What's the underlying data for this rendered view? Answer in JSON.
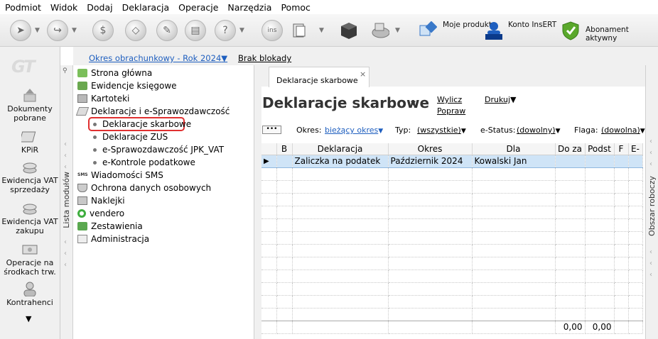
{
  "menu": [
    "Podmiot",
    "Widok",
    "Dodaj",
    "Deklaracja",
    "Operacje",
    "Narzędzia",
    "Pomoc"
  ],
  "toolbar": {
    "moje_produkty": "Moje produkty",
    "konto_insert": "Konto InsERT",
    "abonament": "Abonament aktywny",
    "insert_badge": "InsERT",
    "ins_badge": "ins"
  },
  "logo": "GT",
  "left_strip": [
    {
      "label": "Dokumenty pobrane"
    },
    {
      "label": "KPiR"
    },
    {
      "label": "Ewidencja VAT sprzedaży"
    },
    {
      "label": "Ewidencja VAT zakupu"
    },
    {
      "label": "Operacje na środkach trw."
    },
    {
      "label": "Kontrahenci"
    }
  ],
  "module_strip_label": "Lista modułów",
  "topbar": {
    "okres": "Okres obrachunkowy - Rok 2024",
    "brak_blokady": "Brak blokady"
  },
  "tree": {
    "items": [
      "Strona główna",
      "Ewidencje księgowe",
      "Kartoteki",
      "Deklaracje i e-Sprawozdawczość",
      "Deklaracje skarbowe",
      "Deklaracje ZUS",
      "e-Sprawozdawczość JPK_VAT",
      "e-Kontrole podatkowe",
      "Wiadomości SMS",
      "Ochrona danych osobowych",
      "Naklejki",
      "vendero",
      "Zestawienia",
      "Administracja"
    ],
    "sms_badge": "SMS"
  },
  "tab": {
    "label": "Deklaracje skarbowe",
    "close": "×"
  },
  "main": {
    "title": "Deklaracje skarbowe",
    "wylicz": "Wylicz",
    "popraw": "Popraw",
    "drukuj": "Drukuj",
    "dots": "•••",
    "filters": {
      "okres_label": "Okres:",
      "okres_value": "bieżący okres",
      "typ_label": "Typ:",
      "typ_value": "(wszystkie)",
      "estatus_label": "e-Status:",
      "estatus_value": "(dowolny)",
      "flaga_label": "Flaga:",
      "flaga_value": "(dowolna)"
    },
    "columns": [
      "B",
      "Deklaracja",
      "Okres",
      "Dla",
      "Do za",
      "Podst",
      "F",
      "E-"
    ],
    "rows": [
      {
        "pointer": "▶",
        "b": "",
        "deklaracja": "Zaliczka na podatek",
        "okres": "Październik 2024",
        "dla": "Kowalski Jan",
        "doza": "",
        "podst": "",
        "f": "",
        "e": ""
      }
    ],
    "totals": {
      "doza": "0,00",
      "podst": "0,00"
    }
  },
  "right_strip_label": "Obszar roboczy",
  "colors": {
    "accent_blue": "#1f5fbf",
    "selection": "#cfe4f7",
    "highlight_red": "#e03030"
  }
}
